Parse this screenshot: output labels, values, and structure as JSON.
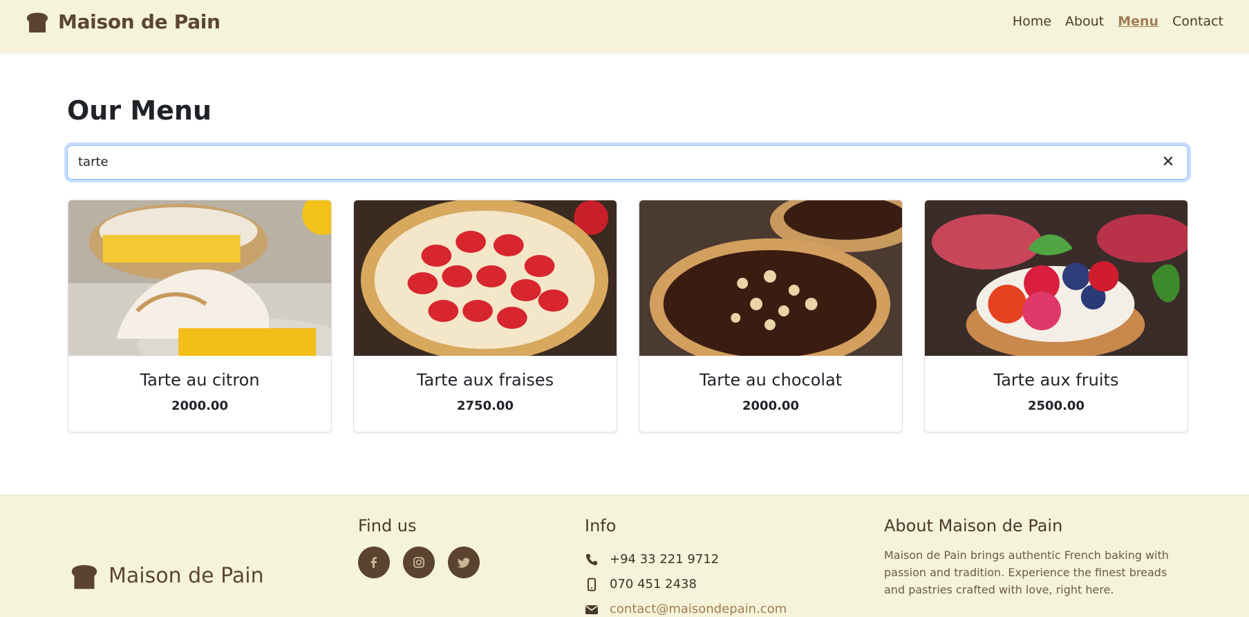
{
  "navbar": {
    "brand": "Maison de Pain",
    "links": [
      {
        "label": "Home",
        "active": false
      },
      {
        "label": "About",
        "active": false
      },
      {
        "label": "Menu",
        "active": true
      },
      {
        "label": "Contact",
        "active": false
      }
    ]
  },
  "main": {
    "title": "Our Menu",
    "search": {
      "value": "tarte",
      "clear_icon": "close-icon"
    }
  },
  "products": [
    {
      "name": "Tarte au citron",
      "price": "2000.00"
    },
    {
      "name": "Tarte aux fraises",
      "price": "2750.00"
    },
    {
      "name": "Tarte au chocolat",
      "price": "2000.00"
    },
    {
      "name": "Tarte aux fruits",
      "price": "2500.00"
    }
  ],
  "footer": {
    "brand": "Maison de Pain",
    "find_us": {
      "title": "Find us",
      "socials": [
        "facebook-icon",
        "instagram-icon",
        "twitter-icon"
      ]
    },
    "info": {
      "title": "Info",
      "phone": "+94 33 221 9712",
      "mobile": "070 451 2438",
      "email": "contact@maisondepain.com"
    },
    "about": {
      "title": "About Maison de Pain",
      "text": "Maison de Pain brings authentic French baking with passion and tradition. Experience the finest breads and pastries crafted with love, right here."
    }
  },
  "colors": {
    "header_bg": "#f5f3da",
    "brand_brown": "#5c4632",
    "active_link": "#a07c55",
    "social_bg": "#5b4330"
  }
}
